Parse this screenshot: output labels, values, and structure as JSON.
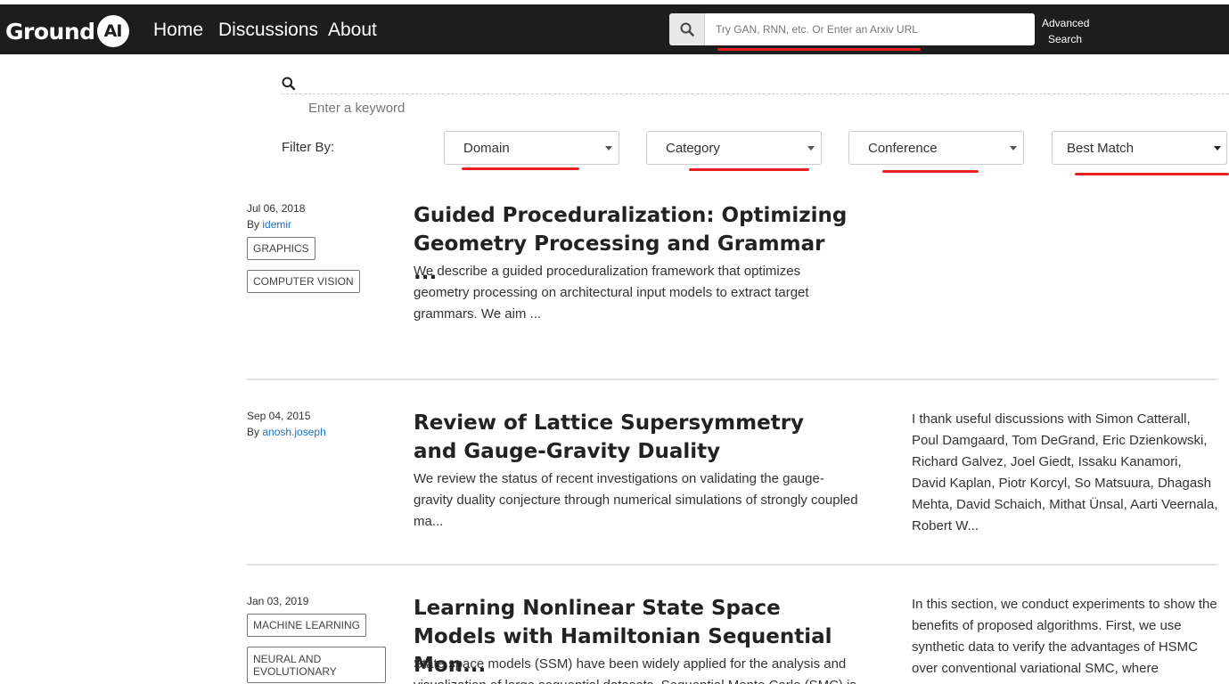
{
  "header": {
    "logo_text": "Ground",
    "logo_badge": "AI",
    "nav": [
      "Home",
      "Discussions",
      "About"
    ],
    "search_placeholder": "Try GAN, RNN, etc. Or Enter an Arxiv URL",
    "advanced_search": [
      "Advanced",
      "Search"
    ]
  },
  "keyword": {
    "placeholder": "Enter a keyword"
  },
  "filters": {
    "label": "Filter By:",
    "domain": "Domain",
    "category": "Category",
    "conference": "Conference",
    "sort": "Best Match"
  },
  "annotation_color": "#e8211f",
  "papers": [
    {
      "date": "Jul 06, 2018",
      "by_label": "By",
      "author": "idemir",
      "tags": [
        "GRAPHICS",
        "COMPUTER VISION"
      ],
      "title": "Guided Proceduralization: Optimizing Geometry Processing and Grammar ...",
      "abstract": "We describe a guided proceduralization framework that optimizes geometry processing on architectural input models to extract target grammars. We aim ...",
      "excerpt": ""
    },
    {
      "date": "Sep 04, 2015",
      "by_label": "By",
      "author": "anosh.joseph",
      "tags": [],
      "title": "Review of Lattice Supersymmetry and Gauge-Gravity Duality",
      "abstract": "We review the status of recent investigations on validating the gauge-gravity duality conjecture through numerical simulations of strongly coupled ma...",
      "excerpt": "I thank useful discussions with Simon Catterall, Poul Damgaard, Tom DeGrand, Eric Dzienkowski, Richard Galvez, Joel Giedt, Issaku Kanamori, David Kaplan, Piotr Korcyl, So Matsuura, Dhagash Mehta, David Schaich, Mithat Ünsal, Aarti Veernala, Robert W..."
    },
    {
      "date": "Jan 03, 2019",
      "tags": [
        "MACHINE LEARNING",
        "NEURAL AND EVOLUTIONARY"
      ],
      "title": "Learning Nonlinear State Space Models with Hamiltonian Sequential Mon...",
      "abstract": "State space models (SSM) have been widely applied for the analysis and visualization of large sequential datasets. Sequential Monte Carlo (SMC) is",
      "excerpt": "In this section, we conduct experiments to show the benefits of proposed algorithms. First, we use synthetic data to verify the advantages of HSMC over conventional variational SMC, where"
    }
  ]
}
